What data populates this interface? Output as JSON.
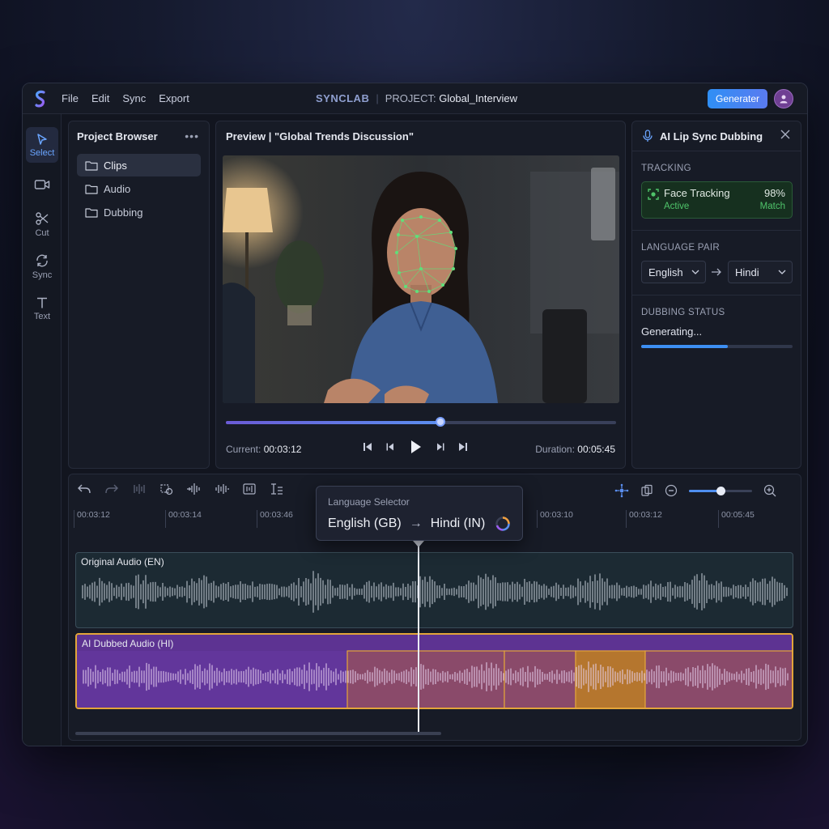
{
  "app": {
    "menu": [
      "File",
      "Edit",
      "Sync",
      "Export"
    ],
    "brand": "SYNCLAB",
    "project_prefix": "PROJECT:",
    "project_name": "Global_Interview",
    "generate_label": "Generater"
  },
  "tools": [
    {
      "label": "Select",
      "icon": "pointer-icon",
      "active": true
    },
    {
      "label": "",
      "icon": "video-icon",
      "active": false
    },
    {
      "label": "Cut",
      "icon": "scissors-icon",
      "active": false
    },
    {
      "label": "Sync",
      "icon": "sync-icon",
      "active": false
    },
    {
      "label": "Text",
      "icon": "text-icon",
      "active": false
    }
  ],
  "browser": {
    "title": "Project Browser",
    "more": "•••",
    "folders": [
      {
        "label": "Clips",
        "active": true
      },
      {
        "label": "Audio",
        "active": false
      },
      {
        "label": "Dubbing",
        "active": false
      }
    ]
  },
  "preview": {
    "title": "Preview | \"Global Trends Discussion\"",
    "current_label": "Current:",
    "current_time": "00:03:12",
    "duration_label": "Duration:",
    "duration_time": "00:05:45",
    "progress": 0.55
  },
  "lipsync": {
    "title": "AI Lip Sync Dubbing",
    "tracking_label": "TRACKING",
    "face_tracking": "Face Tracking",
    "tracking_status": "Active",
    "match_pct": "98%",
    "match_label": "Match",
    "language_pair_label": "LANGUAGE PAIR",
    "source_lang": "English",
    "target_lang": "Hindi",
    "dubbing_status_label": "DUBBING STATUS",
    "dubbing_status": "Generating...",
    "dubbing_progress": 0.57
  },
  "timeline": {
    "ruler": [
      "00:03:12",
      "00:03:14",
      "00:03:46",
      "00:03:10",
      "00:03:12",
      "00:05:45"
    ],
    "zoom_level": 0.5,
    "tracks": {
      "original": "Original Audio (EN)",
      "dubbed": "AI Dubbed Audio (HI)"
    },
    "popup": {
      "title": "Language Selector",
      "source": "English (GB)",
      "target": "Hindi (IN)"
    }
  },
  "colors": {
    "accent": "#3d8ff2",
    "tracking_green": "#4fc46a",
    "dub_purple": "#6a3aa8",
    "dub_orange": "#e3a53a"
  }
}
